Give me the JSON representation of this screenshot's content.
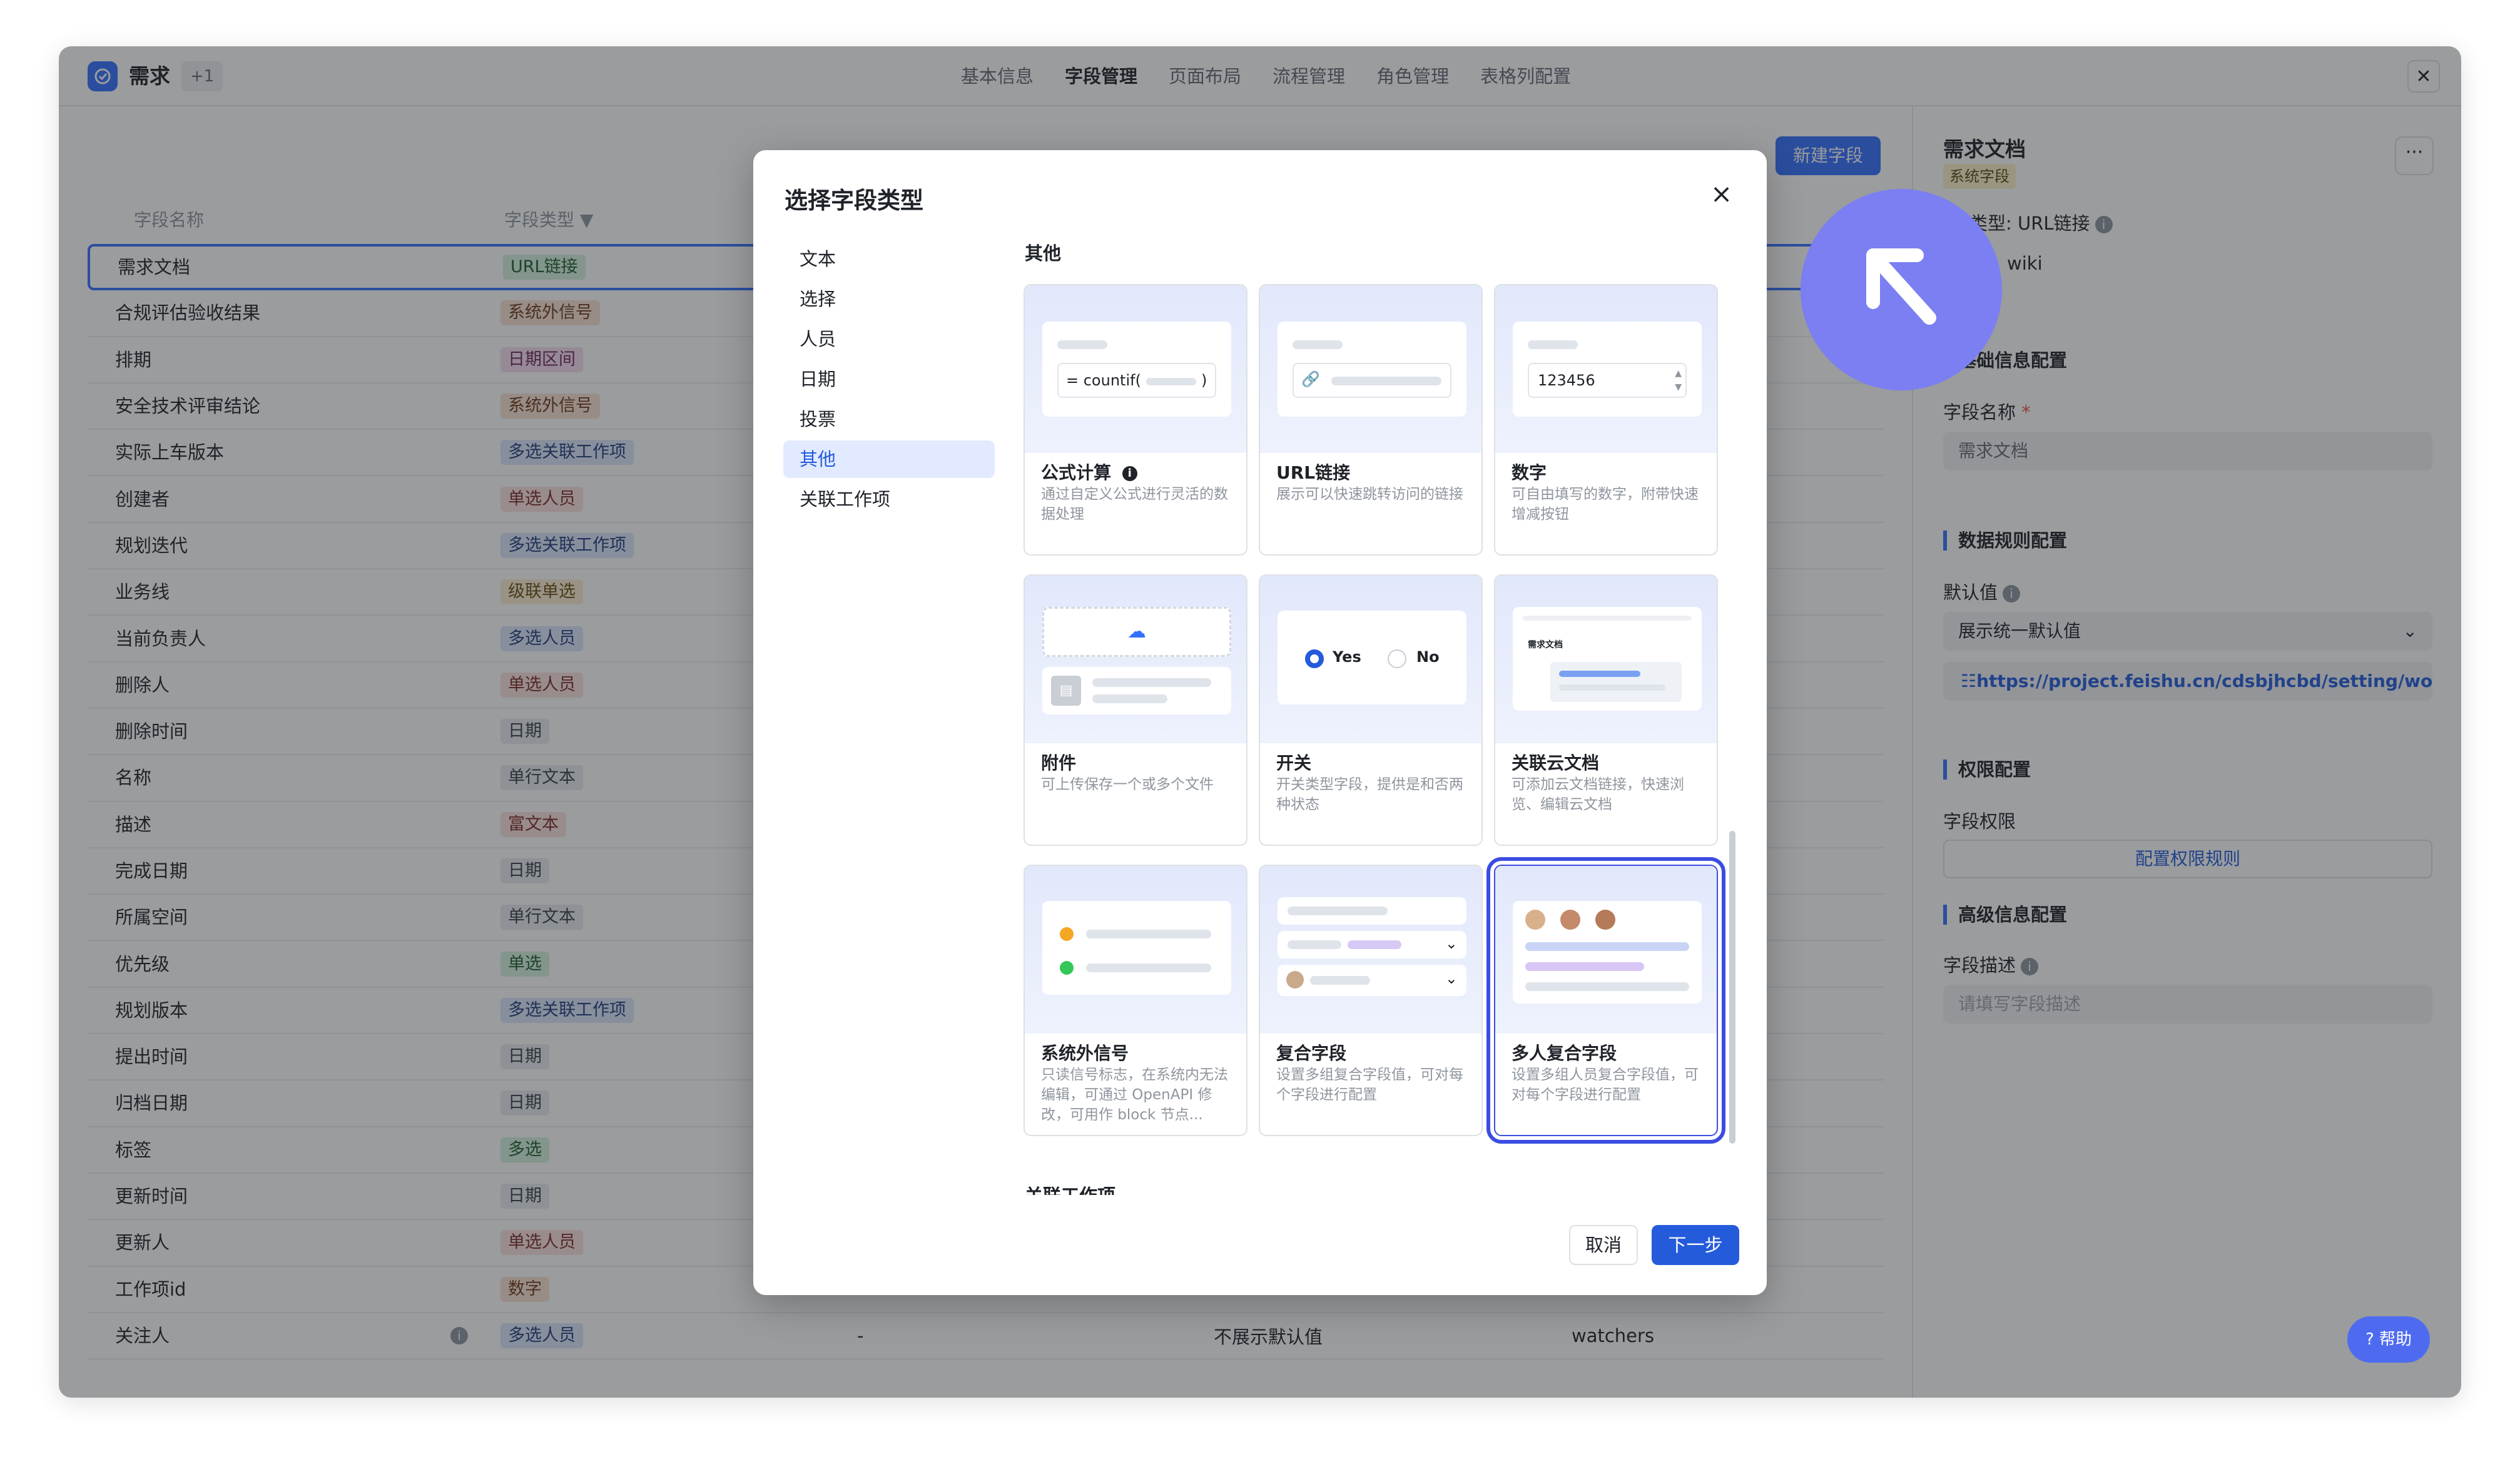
{
  "app": {
    "title": "需求",
    "version": "+1"
  },
  "nav": {
    "tabs": [
      "基本信息",
      "字段管理",
      "页面布局",
      "流程管理",
      "角色管理",
      "表格列配置"
    ],
    "active": 1
  },
  "toolbar": {
    "new_field": "新建字段"
  },
  "table": {
    "headers": {
      "name": "字段名称",
      "type": "字段类型"
    },
    "rows": [
      {
        "name": "需求文档",
        "type": "URL链接",
        "color": "green"
      },
      {
        "name": "合规评估验收结果",
        "type": "系统外信号",
        "color": "orange"
      },
      {
        "name": "排期",
        "type": "日期区间",
        "color": "pink"
      },
      {
        "name": "安全技术评审结论",
        "type": "系统外信号",
        "color": "orange"
      },
      {
        "name": "实际上车版本",
        "type": "多选关联工作项",
        "color": "blue"
      },
      {
        "name": "创建者",
        "type": "单选人员",
        "color": "red"
      },
      {
        "name": "规划迭代",
        "type": "多选关联工作项",
        "color": "blue"
      },
      {
        "name": "业务线",
        "type": "级联单选",
        "color": "yellow"
      },
      {
        "name": "当前负责人",
        "type": "多选人员",
        "color": "blue"
      },
      {
        "name": "删除人",
        "type": "单选人员",
        "color": "red"
      },
      {
        "name": "删除时间",
        "type": "日期",
        "color": "gray"
      },
      {
        "name": "名称",
        "type": "单行文本",
        "color": "gray"
      },
      {
        "name": "描述",
        "type": "富文本",
        "color": "red"
      },
      {
        "name": "完成日期",
        "type": "日期",
        "color": "gray"
      },
      {
        "name": "所属空间",
        "type": "单行文本",
        "color": "gray"
      },
      {
        "name": "优先级",
        "type": "单选",
        "color": "green"
      },
      {
        "name": "规划版本",
        "type": "多选关联工作项",
        "color": "blue"
      },
      {
        "name": "提出时间",
        "type": "日期",
        "color": "gray"
      },
      {
        "name": "归档日期",
        "type": "日期",
        "color": "gray"
      },
      {
        "name": "标签",
        "type": "多选",
        "color": "green"
      },
      {
        "name": "更新时间",
        "type": "日期",
        "color": "gray"
      },
      {
        "name": "更新人",
        "type": "单选人员",
        "color": "red"
      },
      {
        "name": "工作项id",
        "type": "数字",
        "color": "orange"
      }
    ],
    "last_row": {
      "name": "关注人",
      "type": "多选人员",
      "c3": "-",
      "c4": "不展示默认值",
      "c5": "watchers"
    }
  },
  "right_panel": {
    "title": "需求文档",
    "badge": "系统字段",
    "field_type": "类型: URL链接",
    "key_value": "wiki",
    "section_basic": "基础信息配置",
    "field_name_label": "字段名称",
    "required_mark": "*",
    "field_name_value": "需求文档",
    "section_rules": "数据规则配置",
    "default_label": "默认值",
    "default_value": "展示统一默认值",
    "default_link": "https://project.feishu.cn/cdsbjhcbd/setting/wo...",
    "section_perm": "权限配置",
    "perm_label": "字段权限",
    "perm_button": "配置权限规则",
    "section_adv": "高级信息配置",
    "desc_label": "字段描述",
    "desc_placeholder": "请填写字段描述",
    "more": "···"
  },
  "help": "帮助",
  "modal": {
    "title": "选择字段类型",
    "categories": [
      "文本",
      "选择",
      "人员",
      "日期",
      "投票",
      "其他",
      "关联工作项"
    ],
    "active_category": 5,
    "section_title": "其他",
    "next_section_title": "关联工作项",
    "cards": [
      {
        "name": "公式计算",
        "desc": "通过自定义公式进行灵活的数据处理",
        "preview": "= countif(",
        "preview_suffix": ")"
      },
      {
        "name": "URL链接",
        "desc": "展示可以快速跳转访问的链接"
      },
      {
        "name": "数字",
        "desc": "可自由填写的数字，附带快速增减按钮",
        "preview": "123456"
      },
      {
        "name": "附件",
        "desc": "可上传保存一个或多个文件"
      },
      {
        "name": "开关",
        "desc": "开关类型字段，提供是和否两种状态",
        "yes": "Yes",
        "no": "No"
      },
      {
        "name": "关联云文档",
        "desc": "可添加云文档链接，快速浏览、编辑云文档",
        "preview": "需求文档"
      },
      {
        "name": "系统外信号",
        "desc": "只读信号标志，在系统内无法编辑，可通过 OpenAPI 修改，可用作 block 节点..."
      },
      {
        "name": "复合字段",
        "desc": "设置多组复合字段值，可对每个字段进行配置"
      },
      {
        "name": "多人复合字段",
        "desc": "设置多组人员复合字段值，可对每个字段进行配置"
      }
    ],
    "selected_card": 8,
    "cancel": "取消",
    "next": "下一步",
    "close": "×"
  },
  "colors": {
    "accent": "#3370ff",
    "primary_btn": "#245bdb",
    "cursor": "#7b7ff2"
  }
}
